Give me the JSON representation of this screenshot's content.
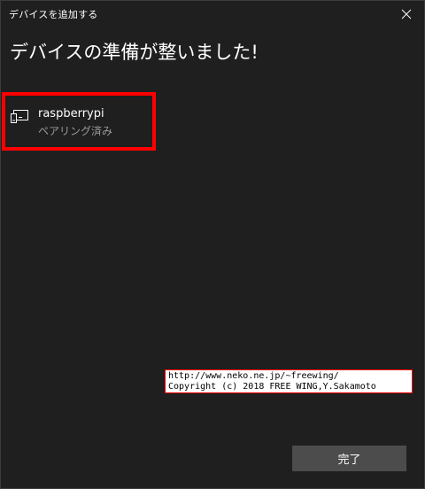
{
  "window": {
    "title": "デバイスを追加する"
  },
  "main": {
    "heading": "デバイスの準備が整いました!"
  },
  "device": {
    "name": "raspberrypi",
    "status": "ペアリング済み",
    "icon": "display-device-icon"
  },
  "watermark": {
    "line1": "http://www.neko.ne.jp/~freewing/",
    "line2": "Copyright (c) 2018 FREE WING,Y.Sakamoto"
  },
  "footer": {
    "done_label": "完了"
  },
  "colors": {
    "background": "#1f1f1f",
    "highlight": "#ff0000",
    "button": "#4c4c4c",
    "secondary_text": "#9a9a9a"
  }
}
